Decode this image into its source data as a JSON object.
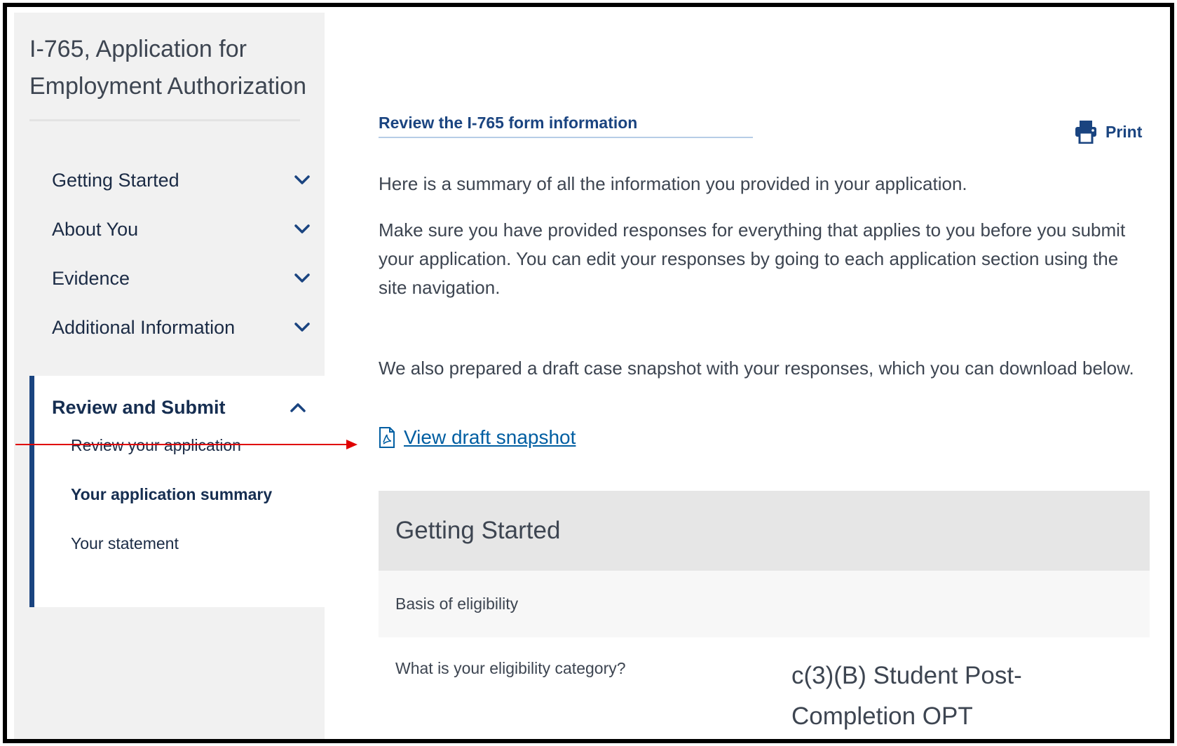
{
  "app": {
    "title": "I-765, Application for Employment Authorization"
  },
  "sidebar": {
    "items": [
      {
        "label": "Getting Started"
      },
      {
        "label": "About You"
      },
      {
        "label": "Evidence"
      },
      {
        "label": "Additional Information"
      }
    ],
    "active_section": {
      "label": "Review and Submit",
      "sub_items": [
        {
          "label": "Review your application"
        },
        {
          "label": "Your application summary"
        },
        {
          "label": "Your statement"
        }
      ]
    }
  },
  "main": {
    "heading": "Review the I-765 form information",
    "print_label": "Print",
    "para1": "Here is a summary of all the information you provided in your application.",
    "para2": "Make sure you have provided responses for everything that applies to you before you submit your application. You can edit your responses by going to each application section using the site navigation.",
    "para3": "We also prepared a draft case snapshot with your responses, which you can download below.",
    "snapshot_link": "View draft snapshot",
    "card": {
      "title": "Getting Started",
      "subtitle": "Basis of eligibility",
      "question": "What is your eligibility category?",
      "answer": "c(3)(B) Student Post-Completion OPT"
    }
  },
  "colors": {
    "brand_blue": "#1a4480",
    "link_blue": "#005ea2",
    "annotation_red": "#e00000"
  }
}
